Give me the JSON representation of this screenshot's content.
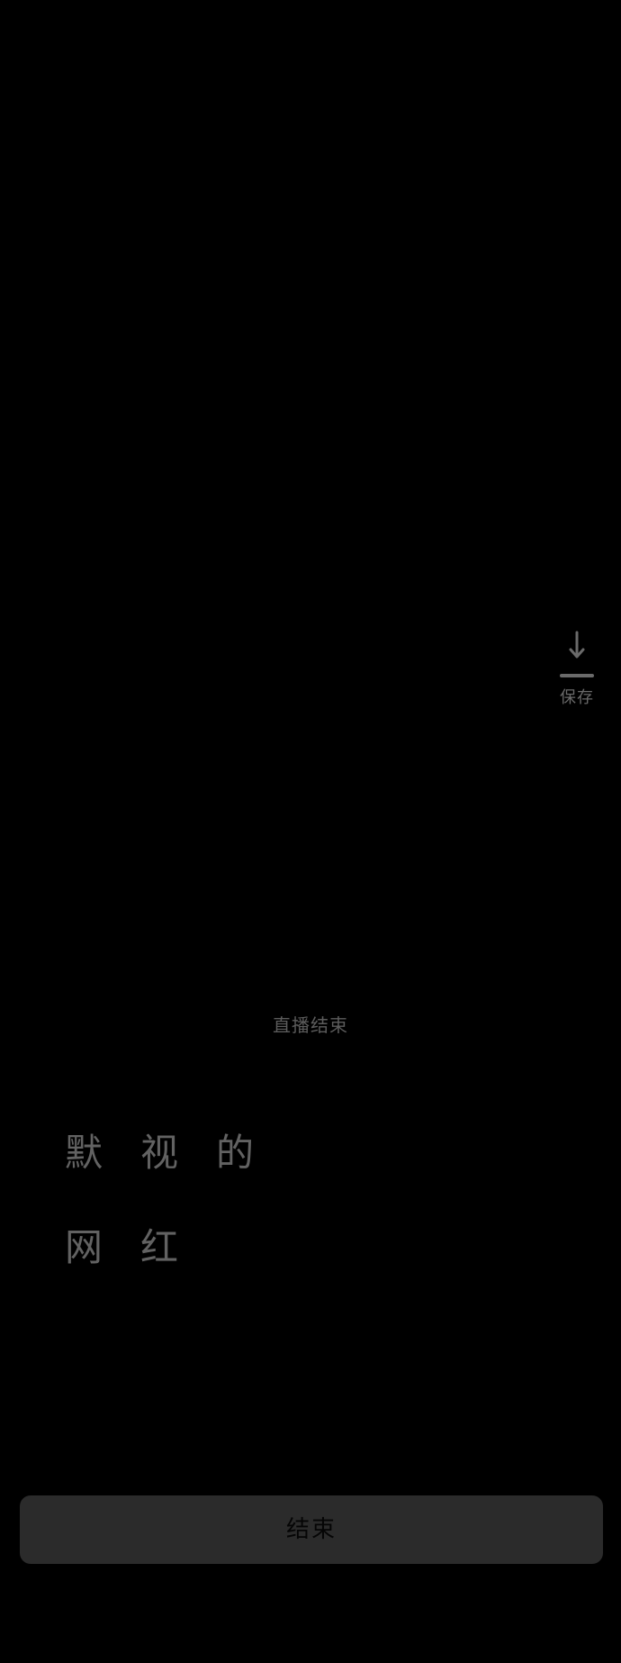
{
  "save": {
    "icon": "download-arrow-icon",
    "label": "保存"
  },
  "status": {
    "text": "直播结束"
  },
  "poem": {
    "lines": [
      "默视的",
      "网红"
    ]
  },
  "end_button": {
    "label": "结束"
  },
  "colors": {
    "background": "#000000",
    "button": "#2b2b2b",
    "text": "#626262"
  }
}
